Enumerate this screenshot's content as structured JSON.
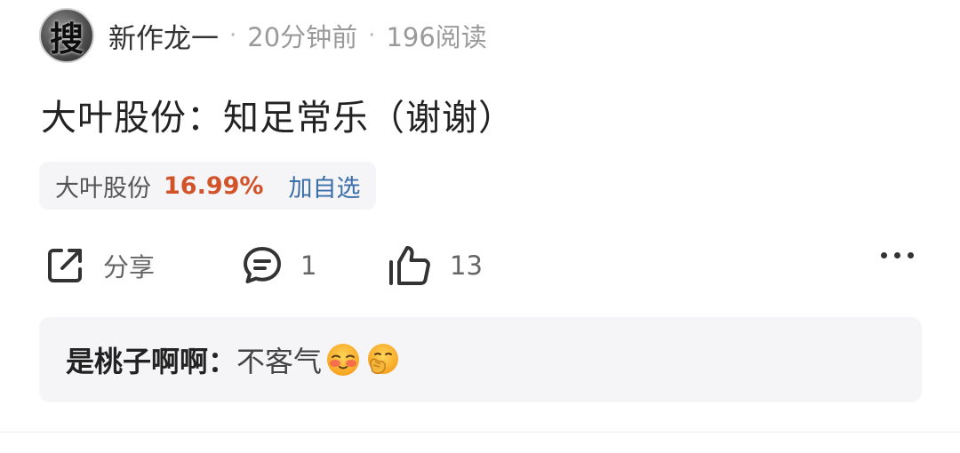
{
  "post": {
    "avatar_glyph": "搜",
    "author": "新作龙一",
    "separator": "·",
    "time": "20分钟前",
    "reads": "196阅读",
    "title": "大叶股份：知足常乐（谢谢）"
  },
  "stock": {
    "name": "大叶股份",
    "change": "16.99%",
    "add_label": "加自选",
    "change_color": "#d2532a",
    "link_color": "#3a6ea8"
  },
  "actions": {
    "share_label": "分享",
    "comment_count": "1",
    "like_count": "13",
    "share_icon": "share-icon",
    "comment_icon": "comment-icon",
    "like_icon": "thumbs-up-icon",
    "more_icon": "more-icon"
  },
  "top_comment": {
    "author": "是桃子啊啊",
    "separator": "：",
    "text": "不客气",
    "emojis": [
      "blushing-face-emoji",
      "hand-over-mouth-emoji"
    ]
  }
}
